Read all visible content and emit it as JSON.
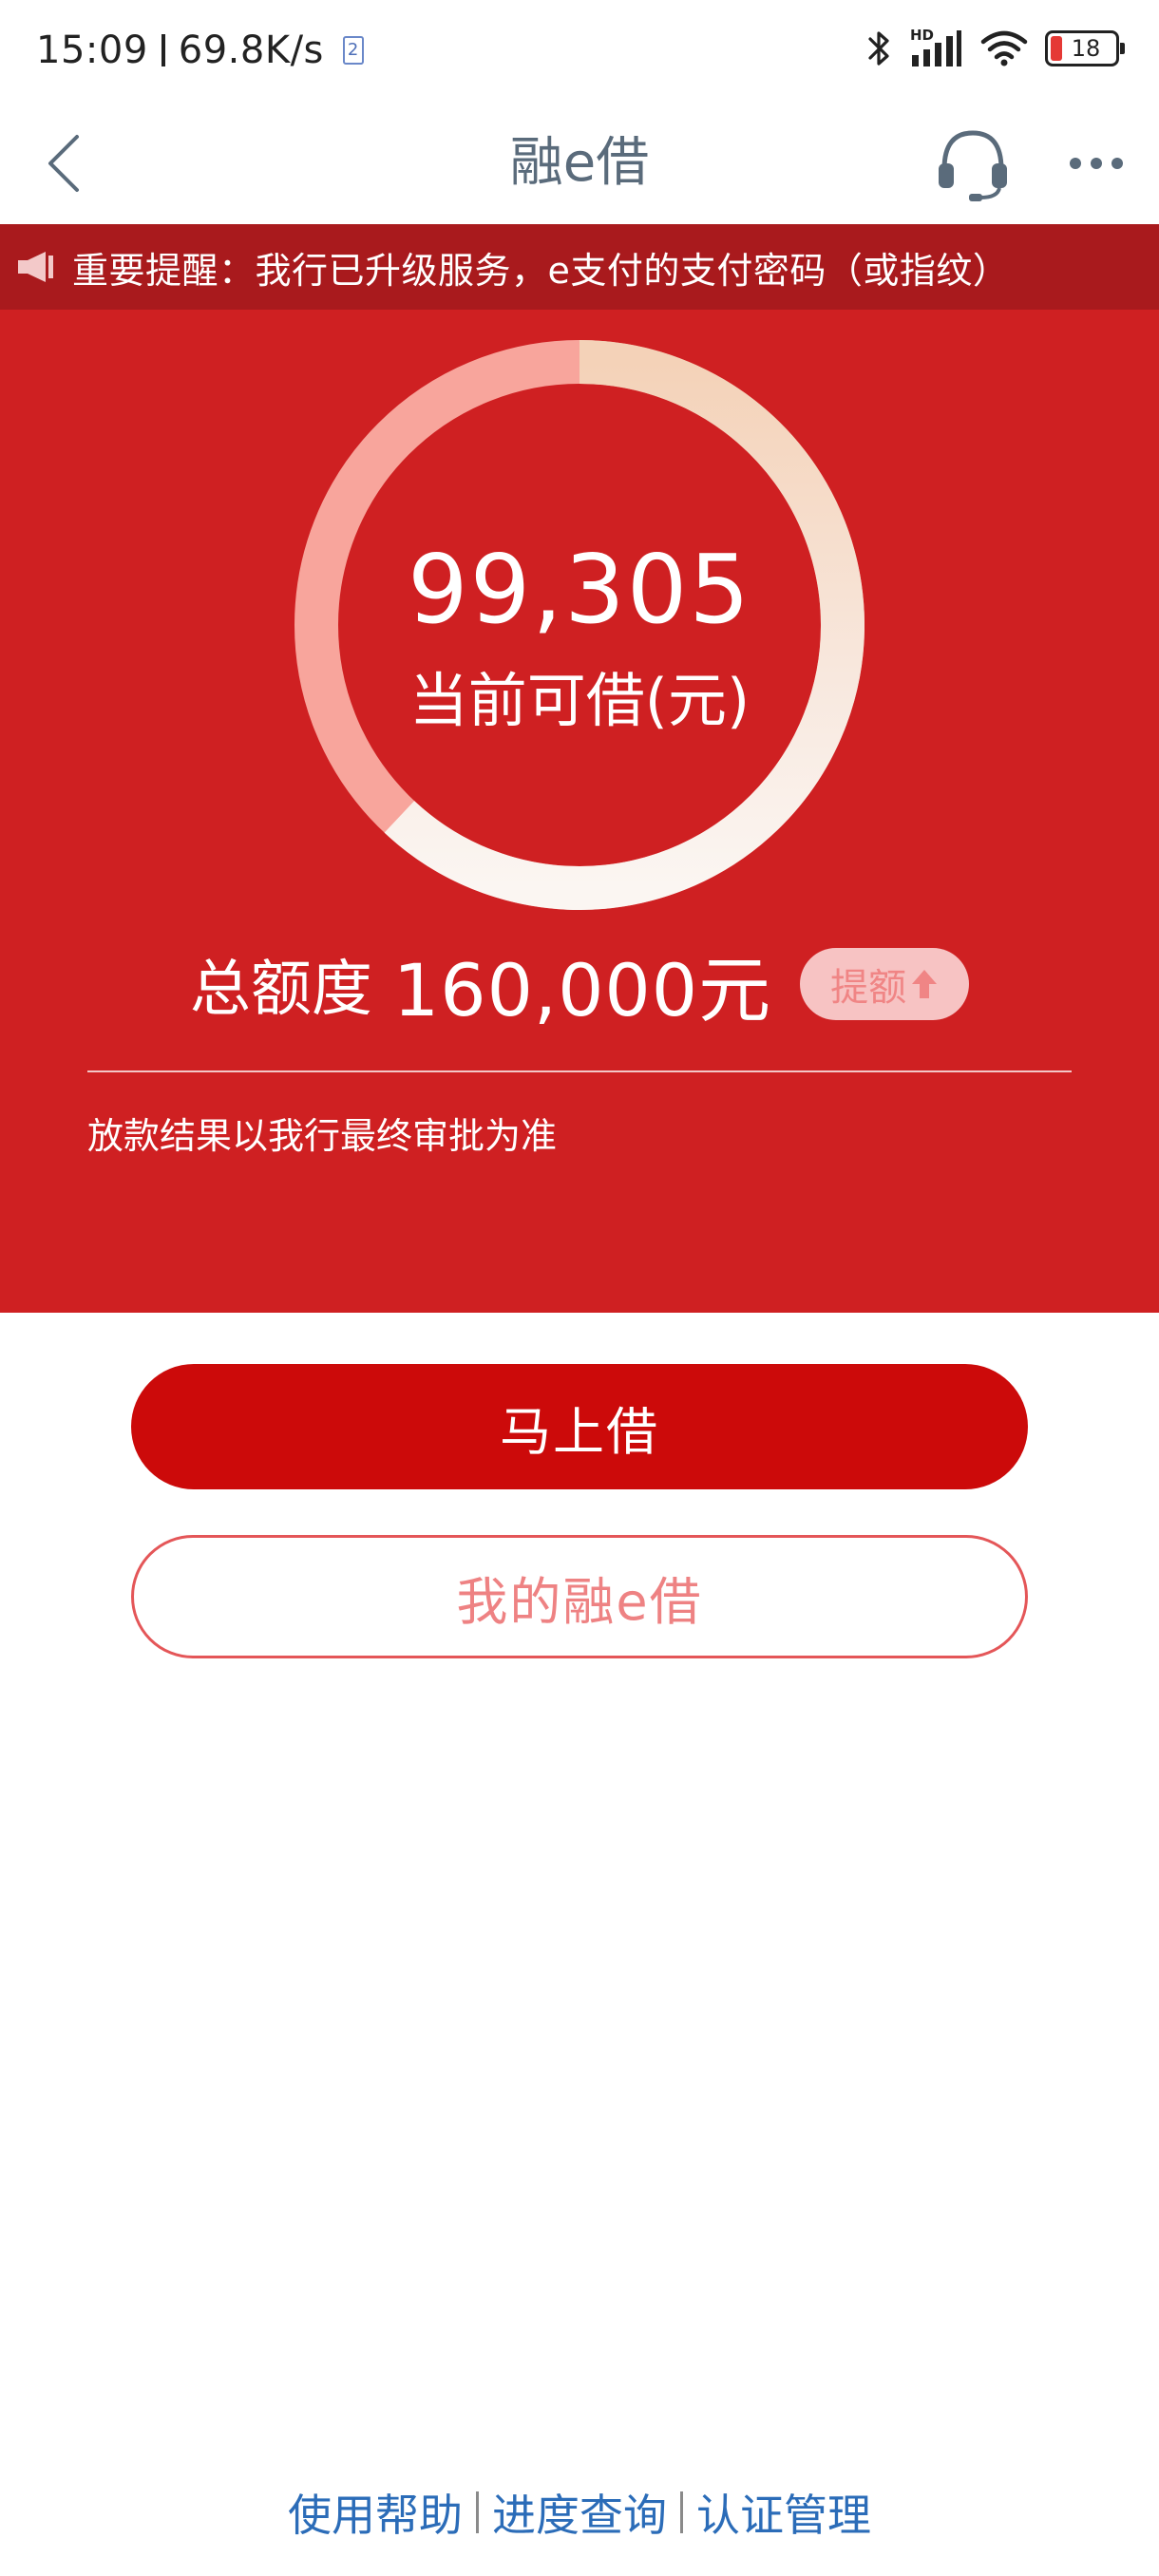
{
  "status_bar": {
    "time": "15:09",
    "network_speed": "69.8K/s",
    "sim_indicator": "2",
    "network_label": "HD",
    "battery_level": "18",
    "icons": [
      "bluetooth-icon",
      "signal-icon",
      "wifi-icon",
      "battery-icon"
    ]
  },
  "nav": {
    "title": "融e借",
    "icons": [
      "back-arrow-icon",
      "headset-icon",
      "more-icon"
    ]
  },
  "notice": {
    "text": "重要提醒：我行已升级服务，e支付的支付密码（或指纹）"
  },
  "hero": {
    "available_amount": "99,305",
    "available_label": "当前可借(元)",
    "limit_label": "总额度",
    "limit_value": "160,000元",
    "available_ratio": 0.62,
    "raise_label": "提额",
    "note": "放款结果以我行最终审批为准"
  },
  "actions": {
    "borrow_now": "马上借",
    "my_loan": "我的融e借"
  },
  "footer": {
    "links": [
      "使用帮助",
      "进度查询",
      "认证管理"
    ]
  },
  "colors": {
    "primary_red": "#cf2022",
    "notice_red": "#a91a1d",
    "button_red": "#cc0a0a",
    "link_blue": "#2b6cb8"
  }
}
